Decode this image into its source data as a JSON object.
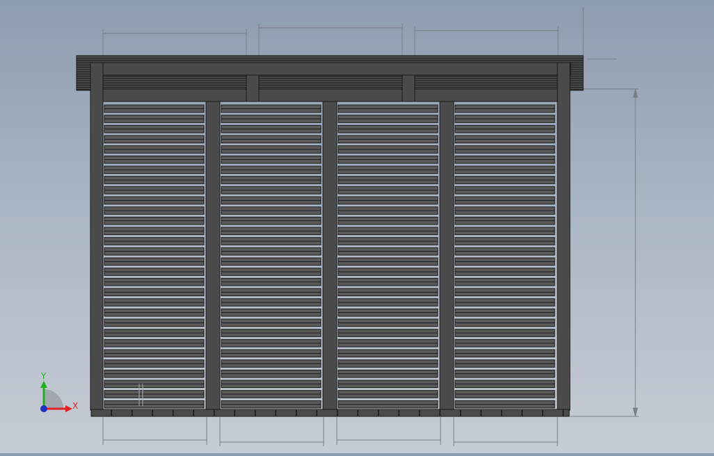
{
  "app": {
    "view": "front-view"
  },
  "colors": {
    "structure": "#4b4b4b",
    "structure_dark": "#2e2e2e",
    "edge": "#1a1a1a",
    "slat_light": "#5a5a5a",
    "dimension_line": "#7a7f86",
    "axis_x": "#e02020",
    "axis_y": "#20b020",
    "axis_origin": "#2030c0"
  },
  "triad": {
    "x_label": "X",
    "y_label": "Y",
    "icon": "xyz-axis-triad-icon"
  },
  "model": {
    "part": "louvered-pergola-wall",
    "bays": 4,
    "slats_per_bay": 30
  }
}
